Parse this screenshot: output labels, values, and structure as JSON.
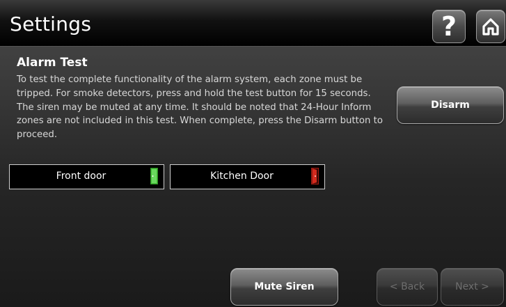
{
  "header": {
    "title": "Settings",
    "help_icon": "help-question-icon",
    "home_icon": "home-icon"
  },
  "section": {
    "title": "Alarm Test",
    "instructions": "To test the complete functionality of the alarm system, each zone must be tripped.  For smoke detectors, press and hold the test button for 15 seconds.  The siren may be muted at any time.  It should be noted that 24-Hour Inform zones are not included in this test.  When complete, press the Disarm button to proceed."
  },
  "buttons": {
    "disarm": "Disarm",
    "mute_siren": "Mute Siren",
    "back": "< Back",
    "next": "Next >"
  },
  "zones": [
    {
      "label": "Front door",
      "status": "closed",
      "icon": "door-closed-icon",
      "color": "#46c03a"
    },
    {
      "label": "Kitchen Door",
      "status": "open",
      "icon": "door-open-icon",
      "color": "#d42a1e"
    }
  ]
}
